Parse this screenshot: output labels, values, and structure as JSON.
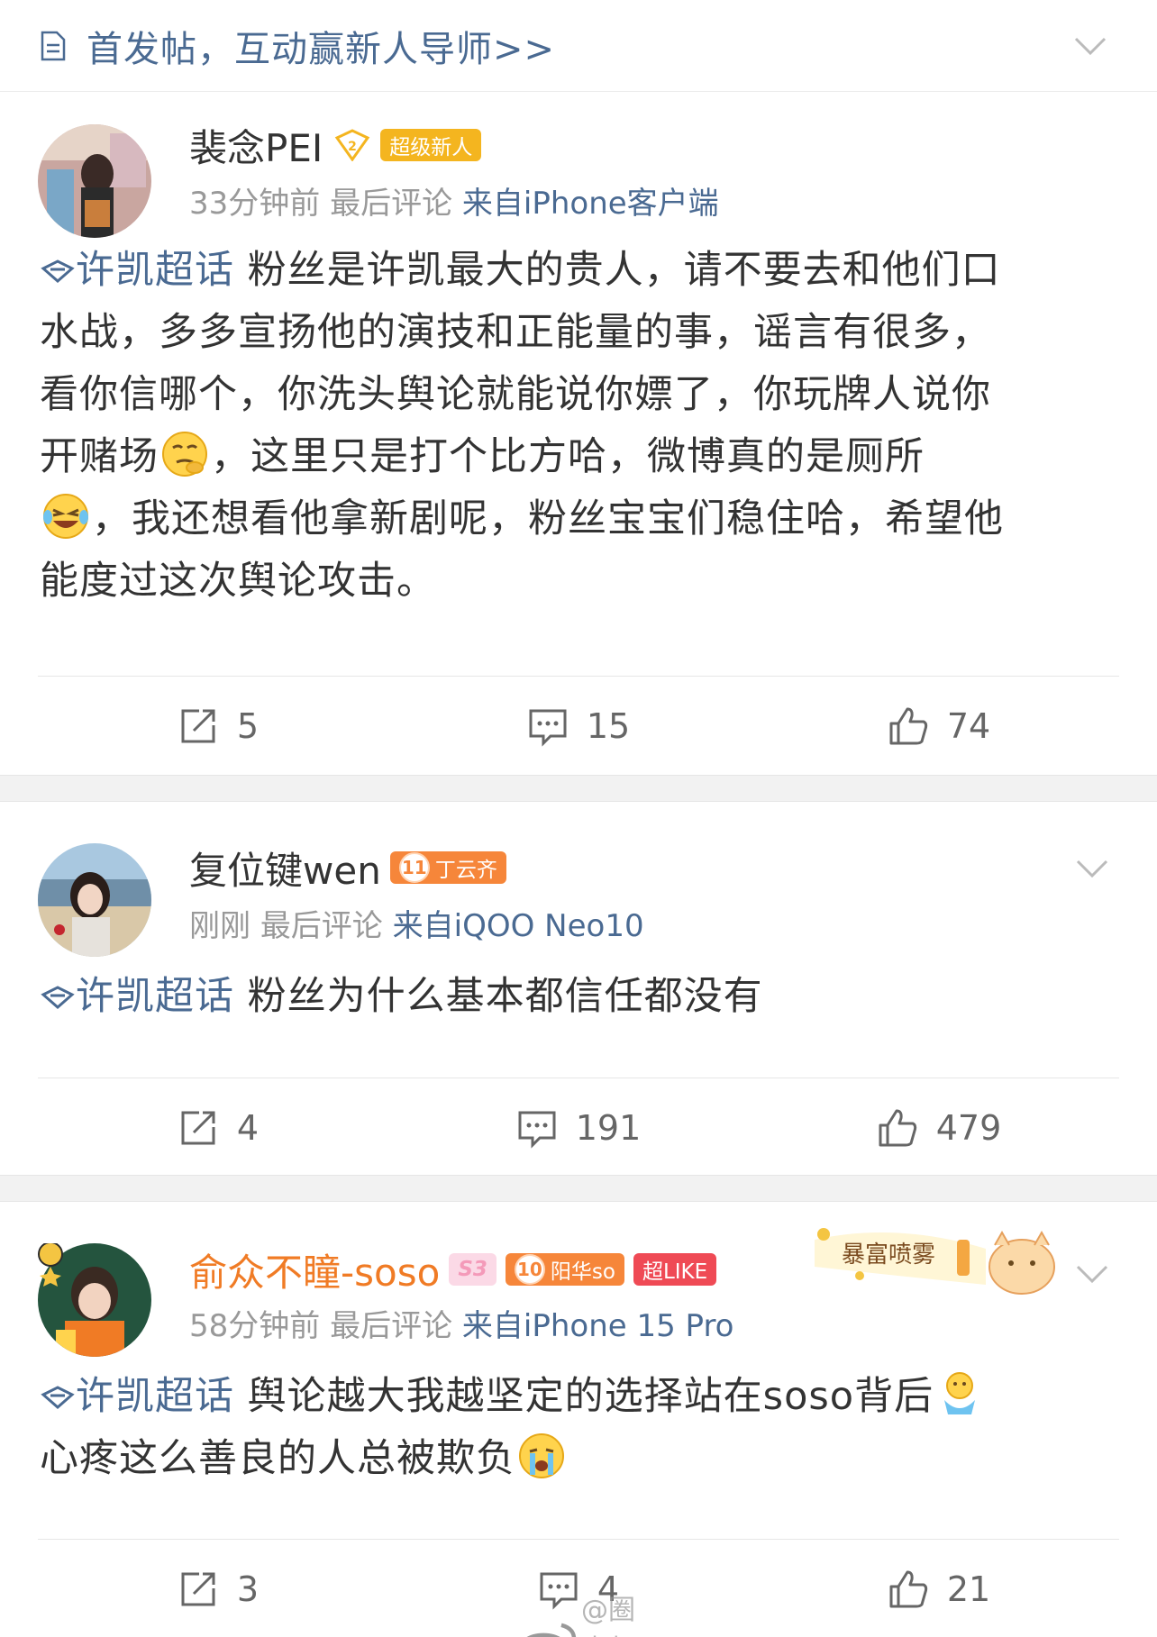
{
  "banner": {
    "text": "首发帖，互动赢新人导师>>"
  },
  "posts": [
    {
      "user_name": "裴念PEI",
      "badges": [
        "超级新人"
      ],
      "time": "33分钟前",
      "last_comment": "最后评论",
      "source": "来自iPhone客户端",
      "topic": "许凯超话",
      "text_1": "粉丝是许凯最大的贵人，请不要去和他们口",
      "text_2": "水战，多多宣扬他的演技和正能量的事，谣言有很多，",
      "text_3": "看你信哪个，你洗头舆论就能说你嫖了，你玩牌人说你",
      "text_4a": "开赌场",
      "text_4b": "，这里只是打个比方哈，微博真的是厕所",
      "text_5": "，我还想看他拿新剧呢，粉丝宝宝们稳住哈，希望他",
      "text_6": "能度过这次舆论攻击。",
      "reposts": "5",
      "comments": "15",
      "likes": "74"
    },
    {
      "user_name": "复位键wen",
      "badge_level": "11",
      "badges": [
        "丁云齐"
      ],
      "time": "刚刚",
      "last_comment": "最后评论",
      "source": "来自iQOO Neo10",
      "topic": "许凯超话",
      "text_1": "粉丝为什么基本都信任都没有",
      "reposts": "4",
      "comments": "191",
      "likes": "479"
    },
    {
      "user_name": "俞众不瞳-soso",
      "badge_s": "S3",
      "badge_level": "10",
      "badges": [
        "阳华so",
        "超LIKE"
      ],
      "decoration": "暴富喷雾",
      "time": "58分钟前",
      "last_comment": "最后评论",
      "source": "来自iPhone 15 Pro",
      "topic": "许凯超话",
      "text_1": "舆论越大我越坚定的选择站在soso背后",
      "text_2": "心疼这么善良的人总被欺负",
      "reposts": "3",
      "comments": "4",
      "likes": "21"
    }
  ],
  "watermark": "@圈内颠公",
  "colors": {
    "link": "#4a6a92",
    "orange_name": "#f07b25",
    "muted": "#999999"
  }
}
